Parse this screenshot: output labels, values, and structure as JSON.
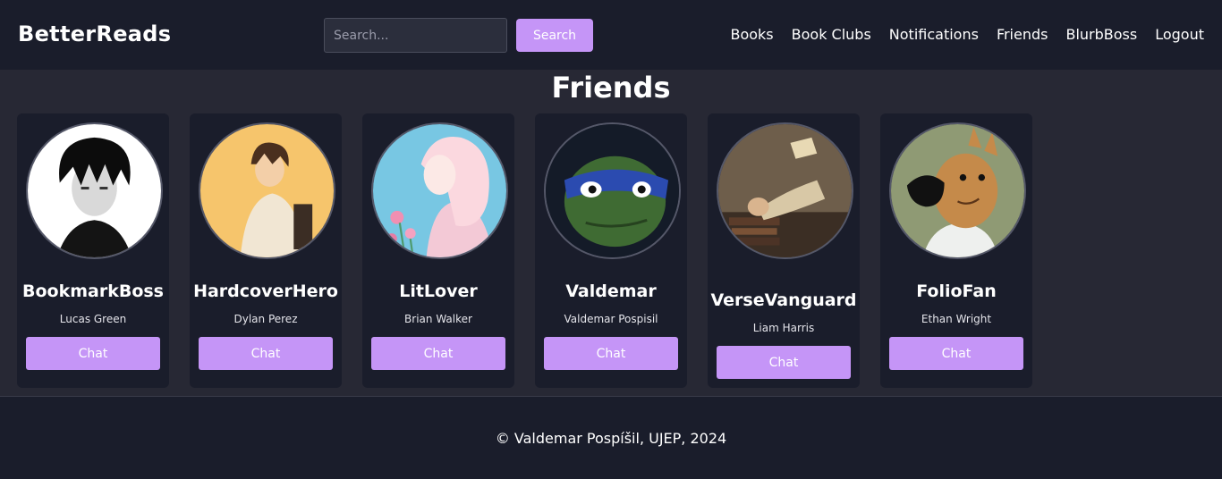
{
  "brand": {
    "name": "BetterReads"
  },
  "search": {
    "placeholder": "Search...",
    "value": "",
    "button_label": "Search"
  },
  "nav": {
    "items": [
      {
        "label": "Books"
      },
      {
        "label": "Book Clubs"
      },
      {
        "label": "Notifications"
      },
      {
        "label": "Friends"
      },
      {
        "label": "BlurbBoss"
      },
      {
        "label": "Logout"
      }
    ]
  },
  "page": {
    "title": "Friends"
  },
  "friends": [
    {
      "username": "BookmarkBoss",
      "full_name": "Lucas Green",
      "chat_label": "Chat",
      "avatar_icon": "dark-haired-anime-boy-avatar"
    },
    {
      "username": "HardcoverHero",
      "full_name": "Dylan Perez",
      "chat_label": "Chat",
      "avatar_icon": "anime-boy-hoodie-avatar"
    },
    {
      "username": "LitLover",
      "full_name": "Brian Walker",
      "chat_label": "Chat",
      "avatar_icon": "anime-girl-flowers-avatar"
    },
    {
      "username": "Valdemar",
      "full_name": "Valdemar Pospisil",
      "chat_label": "Chat",
      "avatar_icon": "ninja-turtle-avatar"
    },
    {
      "username": "VerseVanguard",
      "full_name": "Liam Harris",
      "chat_label": "Chat",
      "avatar_icon": "man-reading-painting-avatar"
    },
    {
      "username": "FolioFan",
      "full_name": "Ethan Wright",
      "chat_label": "Chat",
      "avatar_icon": "cartoon-dog-sweater-avatar"
    }
  ],
  "footer": {
    "text": "© Valdemar Pospíšil, UJEP, 2024"
  },
  "colors": {
    "accent": "#c595f7",
    "background": "#1a1d2b",
    "panel": "#272834"
  }
}
